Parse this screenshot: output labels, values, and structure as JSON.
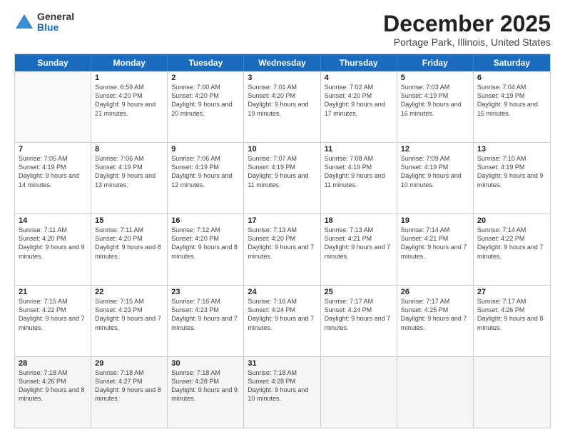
{
  "header": {
    "logo_general": "General",
    "logo_blue": "Blue",
    "month_title": "December 2025",
    "location": "Portage Park, Illinois, United States"
  },
  "days_of_week": [
    "Sunday",
    "Monday",
    "Tuesday",
    "Wednesday",
    "Thursday",
    "Friday",
    "Saturday"
  ],
  "rows": [
    [
      {
        "day": "",
        "info": ""
      },
      {
        "day": "1",
        "info": "Sunrise: 6:59 AM\nSunset: 4:20 PM\nDaylight: 9 hours\nand 21 minutes."
      },
      {
        "day": "2",
        "info": "Sunrise: 7:00 AM\nSunset: 4:20 PM\nDaylight: 9 hours\nand 20 minutes."
      },
      {
        "day": "3",
        "info": "Sunrise: 7:01 AM\nSunset: 4:20 PM\nDaylight: 9 hours\nand 19 minutes."
      },
      {
        "day": "4",
        "info": "Sunrise: 7:02 AM\nSunset: 4:20 PM\nDaylight: 9 hours\nand 17 minutes."
      },
      {
        "day": "5",
        "info": "Sunrise: 7:03 AM\nSunset: 4:19 PM\nDaylight: 9 hours\nand 16 minutes."
      },
      {
        "day": "6",
        "info": "Sunrise: 7:04 AM\nSunset: 4:19 PM\nDaylight: 9 hours\nand 15 minutes."
      }
    ],
    [
      {
        "day": "7",
        "info": "Sunrise: 7:05 AM\nSunset: 4:19 PM\nDaylight: 9 hours\nand 14 minutes."
      },
      {
        "day": "8",
        "info": "Sunrise: 7:06 AM\nSunset: 4:19 PM\nDaylight: 9 hours\nand 13 minutes."
      },
      {
        "day": "9",
        "info": "Sunrise: 7:06 AM\nSunset: 4:19 PM\nDaylight: 9 hours\nand 12 minutes."
      },
      {
        "day": "10",
        "info": "Sunrise: 7:07 AM\nSunset: 4:19 PM\nDaylight: 9 hours\nand 11 minutes."
      },
      {
        "day": "11",
        "info": "Sunrise: 7:08 AM\nSunset: 4:19 PM\nDaylight: 9 hours\nand 11 minutes."
      },
      {
        "day": "12",
        "info": "Sunrise: 7:09 AM\nSunset: 4:19 PM\nDaylight: 9 hours\nand 10 minutes."
      },
      {
        "day": "13",
        "info": "Sunrise: 7:10 AM\nSunset: 4:19 PM\nDaylight: 9 hours\nand 9 minutes."
      }
    ],
    [
      {
        "day": "14",
        "info": "Sunrise: 7:11 AM\nSunset: 4:20 PM\nDaylight: 9 hours\nand 9 minutes."
      },
      {
        "day": "15",
        "info": "Sunrise: 7:11 AM\nSunset: 4:20 PM\nDaylight: 9 hours\nand 8 minutes."
      },
      {
        "day": "16",
        "info": "Sunrise: 7:12 AM\nSunset: 4:20 PM\nDaylight: 9 hours\nand 8 minutes."
      },
      {
        "day": "17",
        "info": "Sunrise: 7:13 AM\nSunset: 4:20 PM\nDaylight: 9 hours\nand 7 minutes."
      },
      {
        "day": "18",
        "info": "Sunrise: 7:13 AM\nSunset: 4:21 PM\nDaylight: 9 hours\nand 7 minutes."
      },
      {
        "day": "19",
        "info": "Sunrise: 7:14 AM\nSunset: 4:21 PM\nDaylight: 9 hours\nand 7 minutes."
      },
      {
        "day": "20",
        "info": "Sunrise: 7:14 AM\nSunset: 4:22 PM\nDaylight: 9 hours\nand 7 minutes."
      }
    ],
    [
      {
        "day": "21",
        "info": "Sunrise: 7:15 AM\nSunset: 4:22 PM\nDaylight: 9 hours\nand 7 minutes."
      },
      {
        "day": "22",
        "info": "Sunrise: 7:15 AM\nSunset: 4:23 PM\nDaylight: 9 hours\nand 7 minutes."
      },
      {
        "day": "23",
        "info": "Sunrise: 7:16 AM\nSunset: 4:23 PM\nDaylight: 9 hours\nand 7 minutes."
      },
      {
        "day": "24",
        "info": "Sunrise: 7:16 AM\nSunset: 4:24 PM\nDaylight: 9 hours\nand 7 minutes."
      },
      {
        "day": "25",
        "info": "Sunrise: 7:17 AM\nSunset: 4:24 PM\nDaylight: 9 hours\nand 7 minutes."
      },
      {
        "day": "26",
        "info": "Sunrise: 7:17 AM\nSunset: 4:25 PM\nDaylight: 9 hours\nand 7 minutes."
      },
      {
        "day": "27",
        "info": "Sunrise: 7:17 AM\nSunset: 4:26 PM\nDaylight: 9 hours\nand 8 minutes."
      }
    ],
    [
      {
        "day": "28",
        "info": "Sunrise: 7:18 AM\nSunset: 4:26 PM\nDaylight: 9 hours\nand 8 minutes."
      },
      {
        "day": "29",
        "info": "Sunrise: 7:18 AM\nSunset: 4:27 PM\nDaylight: 9 hours\nand 8 minutes."
      },
      {
        "day": "30",
        "info": "Sunrise: 7:18 AM\nSunset: 4:28 PM\nDaylight: 9 hours\nand 9 minutes."
      },
      {
        "day": "31",
        "info": "Sunrise: 7:18 AM\nSunset: 4:28 PM\nDaylight: 9 hours\nand 10 minutes."
      },
      {
        "day": "",
        "info": ""
      },
      {
        "day": "",
        "info": ""
      },
      {
        "day": "",
        "info": ""
      }
    ]
  ]
}
